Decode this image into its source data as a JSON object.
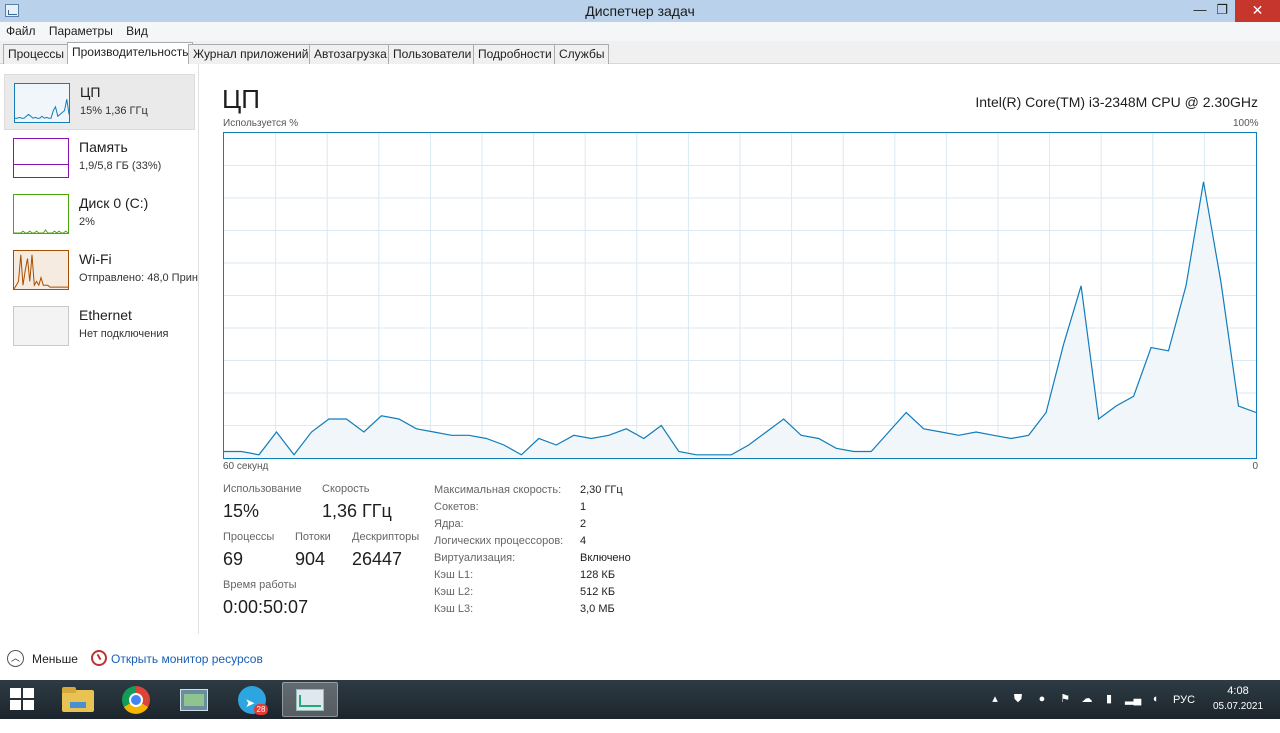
{
  "window": {
    "title": "Диспетчер задач",
    "minimize": "—",
    "maximize": "❐",
    "close": "✕"
  },
  "menu": [
    "Файл",
    "Параметры",
    "Вид"
  ],
  "tabs": [
    "Процессы",
    "Производительность",
    "Журнал приложений",
    "Автозагрузка",
    "Пользователи",
    "Подробности",
    "Службы"
  ],
  "active_tab": "Производительность",
  "sidebar": [
    {
      "title": "ЦП",
      "subtitle": "15% 1,36 ГГц",
      "color": "#117dbb",
      "fill": "#f1f6fa",
      "selected": true,
      "spark": [
        0.1,
        0.1,
        0.12,
        0.1,
        0.1,
        0.15,
        0.2,
        0.15,
        0.1,
        0.12,
        0.1,
        0.1,
        0.15,
        0.1,
        0.12,
        0.1,
        0.1,
        0.3,
        0.4,
        0.15,
        0.2,
        0.25,
        0.3,
        0.6,
        0.2
      ]
    },
    {
      "title": "Память",
      "subtitle": "1,9/5,8 ГБ (33%)",
      "color": "#8b12ae",
      "fill": "#ffffff",
      "selected": false,
      "spark": [
        0.33,
        0.33,
        0.33,
        0.33,
        0.33,
        0.33,
        0.33,
        0.33,
        0.33,
        0.33,
        0.33,
        0.33,
        0.33,
        0.33,
        0.33,
        0.33,
        0.33,
        0.33,
        0.33,
        0.33,
        0.33,
        0.33,
        0.33,
        0.33,
        0.33
      ]
    },
    {
      "title": "Диск 0 (C:)",
      "subtitle": "2%",
      "color": "#4da60c",
      "fill": "#ffffff",
      "selected": false,
      "spark": [
        0,
        0,
        0,
        0,
        0.05,
        0,
        0,
        0.05,
        0,
        0,
        0.05,
        0,
        0,
        0,
        0.08,
        0,
        0,
        0,
        0.05,
        0,
        0.05,
        0,
        0,
        0.05,
        0
      ]
    },
    {
      "title": "Wi-Fi",
      "subtitle": "Отправлено: 48,0 Прин",
      "color": "#a74f01",
      "fill": "#f6ebe0",
      "selected": false,
      "spark": [
        0,
        0.1,
        0.2,
        0.9,
        0.1,
        0.5,
        0.8,
        0.2,
        0.9,
        0.1,
        0.2,
        0.1,
        0.3,
        0.1,
        0.1,
        0.1,
        0.05,
        0.05,
        0.05,
        0.05,
        0.05,
        0.05,
        0.05,
        0.05,
        0.05
      ]
    },
    {
      "title": "Ethernet",
      "subtitle": "Нет подключения",
      "color": "#c9c9c9",
      "fill": "#f3f3f3",
      "selected": false,
      "spark": []
    }
  ],
  "main": {
    "title": "ЦП",
    "cpu_name": "Intel(R) Core(TM) i3-2348M CPU @ 2.30GHz",
    "usage_label": "Используется %",
    "max_label": "100%",
    "time_label": "60 секунд",
    "zero_label": "0",
    "graph_color": "#117dbb",
    "graph_fill": "#f1f6fa",
    "grid_color": "#d9eaf4"
  },
  "chart_data": {
    "type": "area",
    "title": "",
    "xlabel": "60 секунд",
    "ylabel": "Используется %",
    "ylim": [
      0,
      100
    ],
    "xlim": [
      60,
      0
    ],
    "grid": true,
    "series": [
      {
        "name": "",
        "values": [
          2,
          2,
          1,
          8,
          1,
          8,
          12,
          12,
          8,
          13,
          12,
          9,
          8,
          7,
          7,
          6,
          4,
          1,
          6,
          4,
          7,
          6,
          7,
          9,
          6,
          10,
          2,
          1,
          1,
          1,
          4,
          8,
          12,
          7,
          6,
          3,
          2,
          2,
          8,
          14,
          9,
          8,
          7,
          8,
          7,
          6,
          7,
          14,
          35,
          53,
          12,
          16,
          19,
          34,
          33,
          53,
          85,
          54,
          16,
          14
        ]
      }
    ]
  },
  "stats": {
    "usage": {
      "label": "Использование",
      "value": "15%"
    },
    "speed": {
      "label": "Скорость",
      "value": "1,36 ГГц"
    },
    "processes": {
      "label": "Процессы",
      "value": "69"
    },
    "threads": {
      "label": "Потоки",
      "value": "904"
    },
    "handles": {
      "label": "Дескрипторы",
      "value": "26447"
    },
    "uptime": {
      "label": "Время работы",
      "value": "0:00:50:07"
    }
  },
  "details": [
    {
      "key": "Максимальная скорость:",
      "value": "2,30 ГГц"
    },
    {
      "key": "Сокетов:",
      "value": "1"
    },
    {
      "key": "Ядра:",
      "value": "2"
    },
    {
      "key": "Логических процессоров:",
      "value": "4"
    },
    {
      "key": "Виртуализация:",
      "value": "Включено"
    },
    {
      "key": "Кэш L1:",
      "value": "128 КБ"
    },
    {
      "key": "Кэш L2:",
      "value": "512 КБ"
    },
    {
      "key": "Кэш L3:",
      "value": "3,0 МБ"
    }
  ],
  "footer": {
    "less_label": "Меньше",
    "monitor_label": "Открыть монитор ресурсов"
  },
  "taskbar": {
    "apps": [
      "file-explorer-icon",
      "chrome-icon",
      "app-icon",
      "telegram-icon",
      "task-manager-icon"
    ],
    "telegram_badge": "28",
    "lang": "РУС",
    "time": "4:08",
    "date": "05.07.2021"
  }
}
